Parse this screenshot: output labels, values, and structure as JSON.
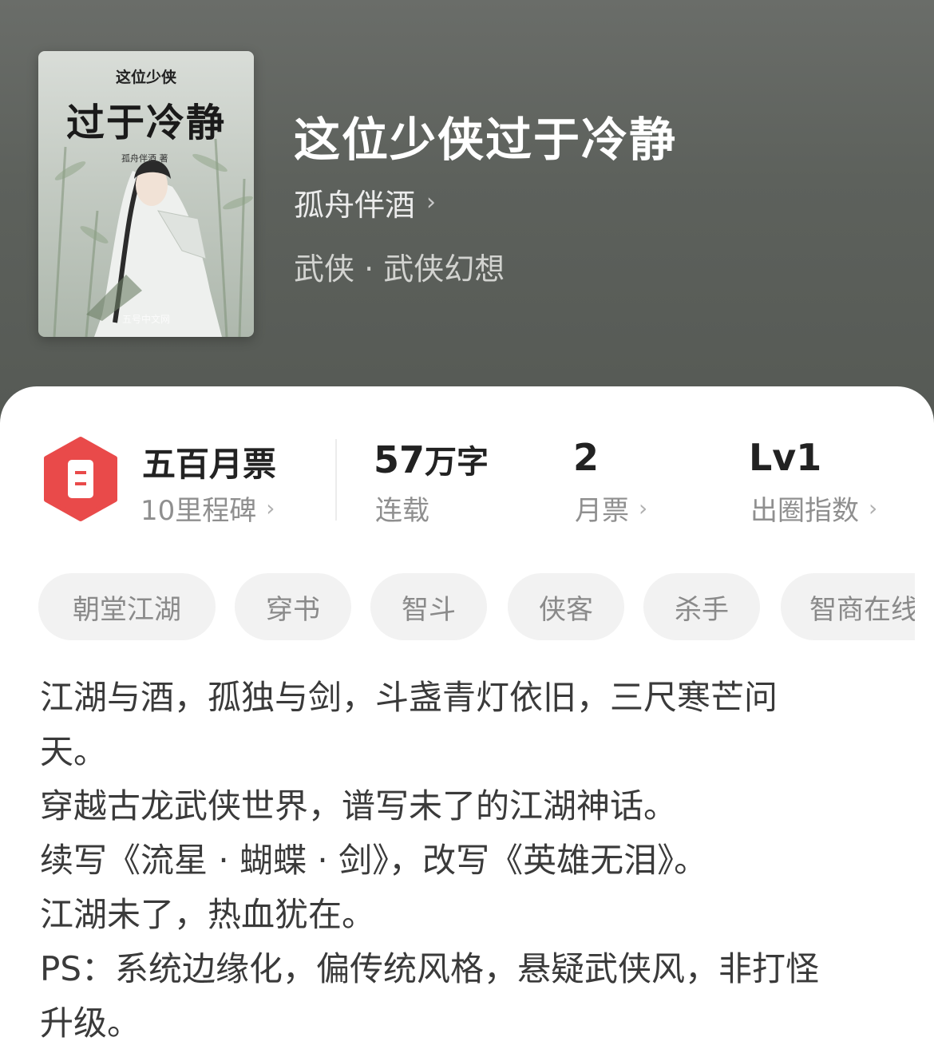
{
  "book": {
    "title": "这位少侠过于冷静",
    "author": "孤舟伴酒",
    "genre": "武侠 · 武侠幻想"
  },
  "cover": {
    "small_title": "这位少侠",
    "big_title": "过于冷静",
    "author": "孤舟伴酒 著",
    "site": "五号中文网"
  },
  "stats": {
    "ticket": {
      "main": "五百月票",
      "sub": "10里程碑"
    },
    "words": {
      "number": "57",
      "unit": "万字",
      "sub": "连载"
    },
    "monthly_votes": {
      "main": "2",
      "sub": "月票"
    },
    "level": {
      "main": "Lv1",
      "sub": "出圈指数"
    }
  },
  "tags": [
    "朝堂江湖",
    "穿书",
    "智斗",
    "侠客",
    "杀手",
    "智商在线"
  ],
  "description": [
    "江湖与酒，孤独与剑，斗盏青灯依旧，三尺寒芒问",
    "天。",
    "穿越古龙武侠世界，谱写未了的江湖神话。",
    "续写《流星 · 蝴蝶 · 剑》，改写《英雄无泪》。",
    "江湖未了，热血犹在。",
    "PS：系统边缘化，偏传统风格，悬疑武侠风，非打怪",
    "升级。"
  ],
  "colors": {
    "header_bg": "#5d615c",
    "ticket_red": "#e94a4a",
    "tag_bg": "#f2f2f2"
  },
  "icons": [
    "ticket-icon",
    "chevron-right-icon"
  ]
}
